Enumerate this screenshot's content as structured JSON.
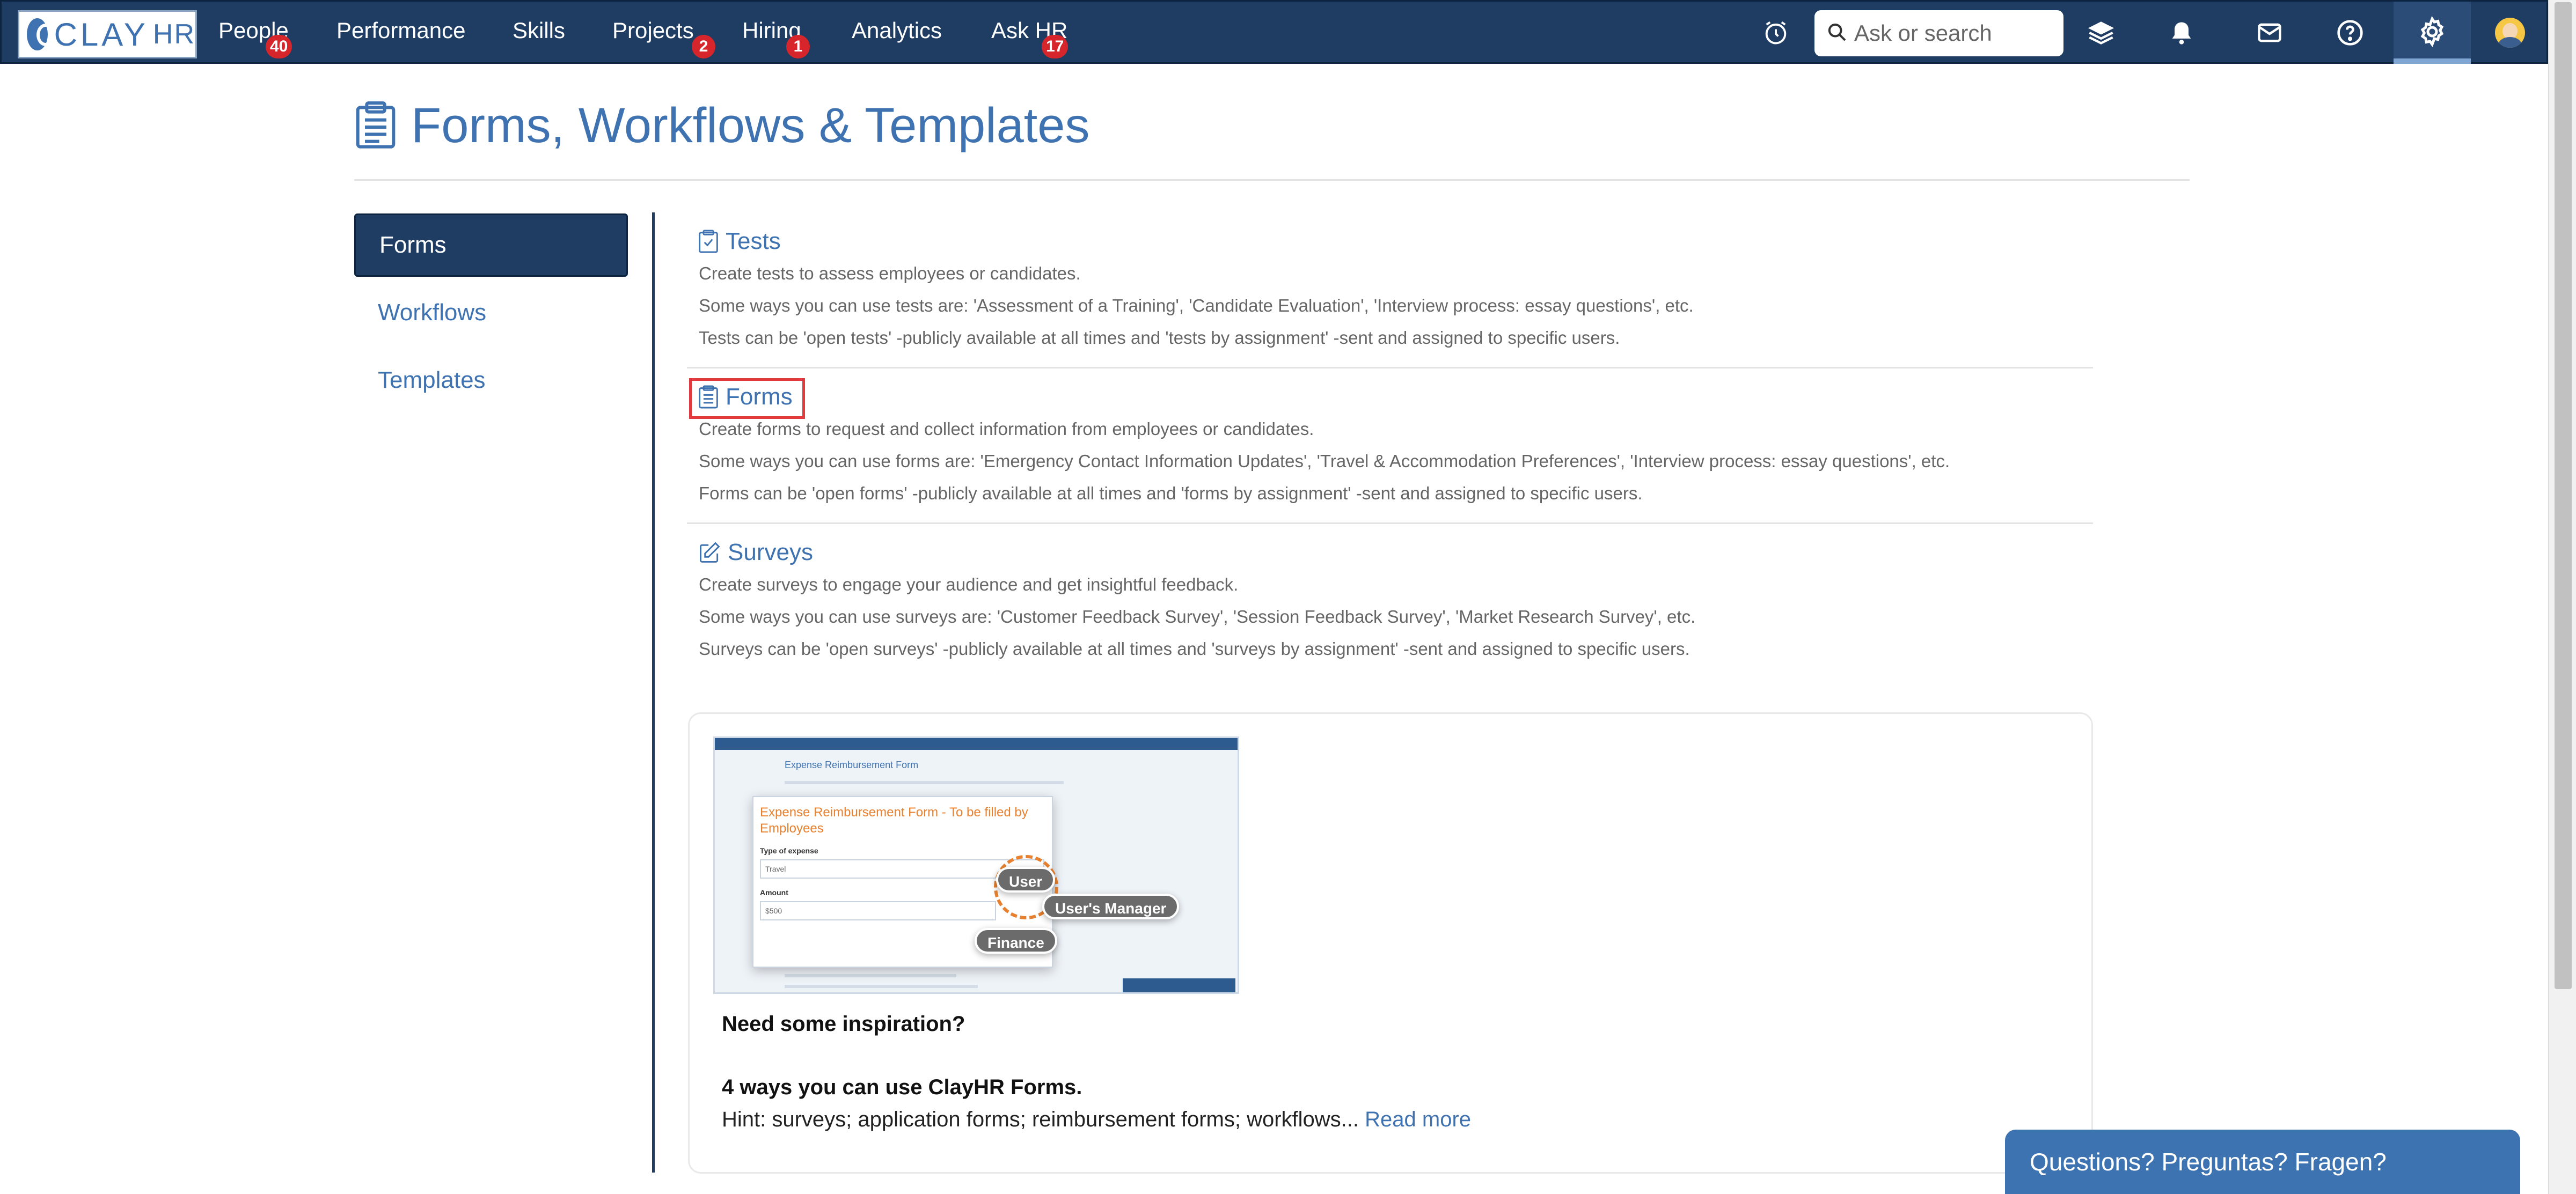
{
  "app": {
    "logo_text": "CLAY",
    "logo_suffix": "HR"
  },
  "nav": {
    "items": [
      {
        "label": "People",
        "badge": "40"
      },
      {
        "label": "Performance",
        "badge": null
      },
      {
        "label": "Skills",
        "badge": null
      },
      {
        "label": "Projects",
        "badge": "2"
      },
      {
        "label": "Hiring",
        "badge": "1"
      },
      {
        "label": "Analytics",
        "badge": null
      },
      {
        "label": "Ask HR",
        "badge": "17"
      }
    ],
    "search_placeholder": "Ask or search",
    "icons": [
      "alarm-clock-icon",
      "search-icon",
      "layers-icon",
      "bell-icon",
      "mail-icon",
      "help-icon",
      "gear-icon",
      "avatar"
    ],
    "brand_color": "#1f3d63",
    "badge_color": "#d6262b"
  },
  "page": {
    "title": "Forms, Workflows & Templates",
    "title_icon": "clipboard-icon"
  },
  "sidebar": {
    "items": [
      {
        "label": "Forms",
        "active": true
      },
      {
        "label": "Workflows",
        "active": false
      },
      {
        "label": "Templates",
        "active": false
      }
    ]
  },
  "sections": [
    {
      "title": "Tests",
      "icon": "clipboard-check-icon",
      "lines": [
        "Create tests to assess employees or candidates.",
        "Some ways you can use tests are: 'Assessment of a Training', 'Candidate Evaluation', 'Interview process: essay questions', etc.",
        "Tests can be 'open tests' -publicly available at all times and 'tests by assignment' -sent and assigned to specific users."
      ]
    },
    {
      "title": "Forms",
      "icon": "form-icon",
      "highlighted": true,
      "lines": [
        "Create forms to request and collect information from employees or candidates.",
        "Some ways you can use forms are: 'Emergency Contact Information Updates', 'Travel & Accommodation Preferences', 'Interview process: essay questions', etc.",
        "Forms can be 'open forms' -publicly available at all times and 'forms by assignment' -sent and assigned to specific users."
      ]
    },
    {
      "title": "Surveys",
      "icon": "edit-icon",
      "lines": [
        "Create surveys to engage your audience and get insightful feedback.",
        "Some ways you can use surveys are: 'Customer Feedback Survey', 'Session Feedback Survey', 'Market Research Survey', etc.",
        "Surveys can be 'open surveys' -publicly available at all times and 'surveys by assignment' -sent and assigned to specific users."
      ]
    }
  ],
  "inspiration": {
    "thumbnail": {
      "header": "Expense Reimbursement Form",
      "panel_title": "Expense Reimbursement Form - To be filled by Employees",
      "field1_label": "Type of expense",
      "field1_value": "Travel",
      "field2_label": "Amount",
      "field2_value": "$500",
      "chip_user": "User",
      "chip_manager": "User's Manager",
      "chip_finance": "Finance"
    },
    "heading": "Need some inspiration?",
    "subheading": "4 ways you can use ClayHR Forms.",
    "hint": "Hint: surveys; application forms; reimbursement forms; workflows...",
    "read_more": "Read more"
  },
  "chat": {
    "label": "Questions? Preguntas? Fragen?"
  }
}
